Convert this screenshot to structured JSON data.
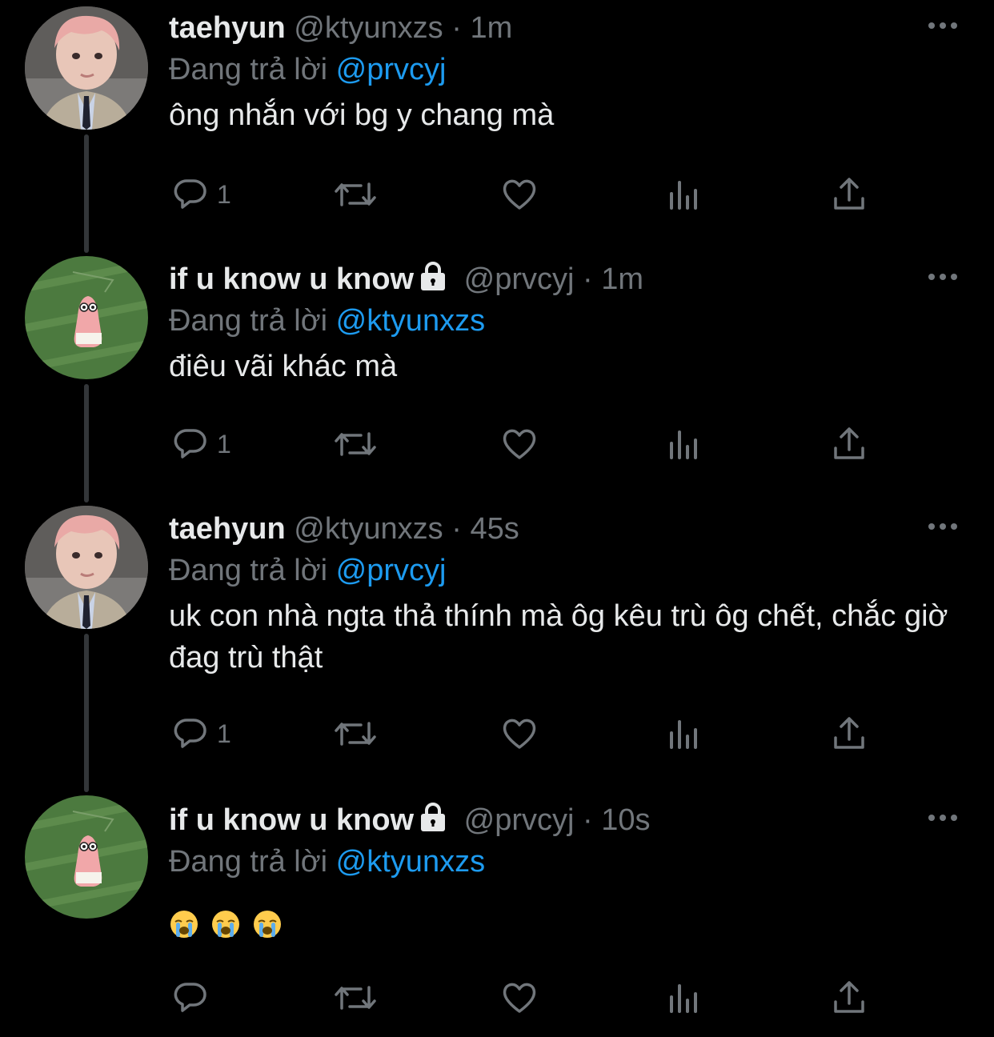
{
  "tweets": [
    {
      "name": "taehyun",
      "handle": "@ktyunxzs",
      "time": "· 1m",
      "reply_prefix": "Đang trả lời",
      "reply_handle": "@prvcyj",
      "body": "ông nhắn với bg y chang mà",
      "reply_count": "1",
      "avatar": "person-avatar",
      "locked": false
    },
    {
      "name": "if u know u know",
      "handle": "@prvcyj",
      "time": "· 1m",
      "reply_prefix": "Đang trả lời",
      "reply_handle": "@ktyunxzs",
      "body": "điêu vãi khác mà",
      "reply_count": "1",
      "avatar": "patrick-avatar",
      "locked": true
    },
    {
      "name": "taehyun",
      "handle": "@ktyunxzs",
      "time": "· 45s",
      "reply_prefix": "Đang trả lời",
      "reply_handle": "@prvcyj",
      "body": "uk con nhà ngta thả thính mà ôg kêu trù ôg chết, chắc giờ đag trù thật",
      "reply_count": "1",
      "avatar": "person-avatar",
      "locked": false
    },
    {
      "name": "if u know u know",
      "handle": "@prvcyj",
      "time": "· 10s",
      "reply_prefix": "Đang trả lời",
      "reply_handle": "@ktyunxzs",
      "body": "😭 😭 😭",
      "reply_count": "",
      "avatar": "patrick-avatar",
      "locked": true
    }
  ],
  "icons": {
    "reply": "comment-icon",
    "retweet": "retweet-icon",
    "like": "heart-icon",
    "analytics": "analytics-icon",
    "share": "share-icon",
    "more": "more-icon",
    "lock": "lock-icon",
    "emoji": "loudly-crying-face-emoji"
  },
  "colors": {
    "background": "#000000",
    "text": "#e7e9ea",
    "secondary": "#71767b",
    "link": "#1d9bf0",
    "thread_line": "#333639"
  }
}
